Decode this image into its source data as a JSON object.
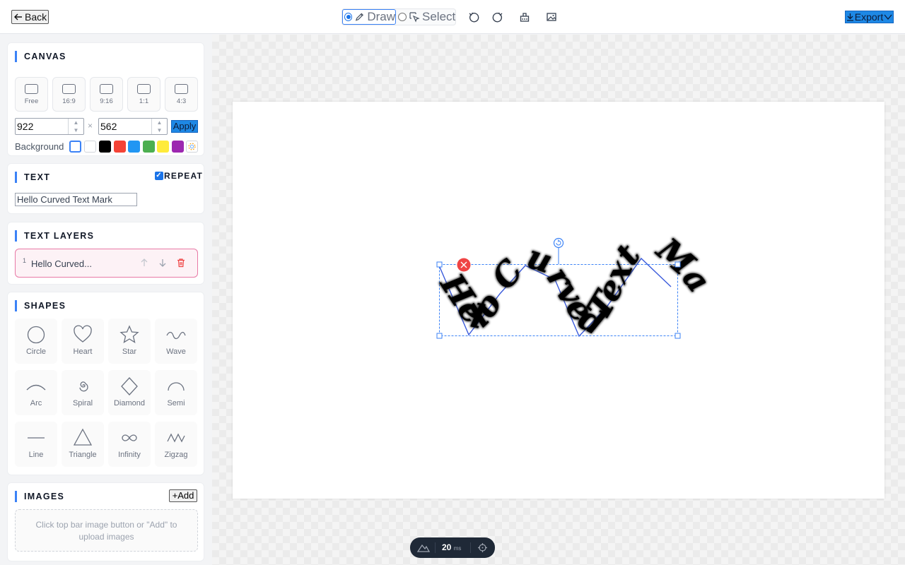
{
  "topbar": {
    "back_label": "Back",
    "modes": {
      "draw": "Draw",
      "select": "Select",
      "active": "draw"
    },
    "export_label": "Export"
  },
  "canvas_card": {
    "title": "CANVAS",
    "ratios": [
      {
        "label": "Free"
      },
      {
        "label": "16:9"
      },
      {
        "label": "9:16"
      },
      {
        "label": "1:1"
      },
      {
        "label": "4:3"
      }
    ],
    "width_value": "922",
    "height_value": "562",
    "times_symbol": "×",
    "apply_label": "Apply",
    "background_label": "Background",
    "background_colors": [
      "#ffffff",
      "#ffffff",
      "#000000",
      "#f44336",
      "#2196f3",
      "#4caf50",
      "#ffeb3b",
      "#9c27b0"
    ]
  },
  "text_card": {
    "title": "TEXT",
    "repeat_label": "REPEAT",
    "repeat_checked": true,
    "text_value": "Hello Curved Text Mark"
  },
  "layers_card": {
    "title": "TEXT LAYERS",
    "layers": [
      {
        "index": "1",
        "name": "Hello Curved..."
      }
    ]
  },
  "shapes_card": {
    "title": "SHAPES",
    "shapes": [
      {
        "label": "Circle",
        "icon": "circle-icon"
      },
      {
        "label": "Heart",
        "icon": "heart-icon"
      },
      {
        "label": "Star",
        "icon": "star-icon"
      },
      {
        "label": "Wave",
        "icon": "wave-icon"
      },
      {
        "label": "Arc",
        "icon": "arc-icon"
      },
      {
        "label": "Spiral",
        "icon": "spiral-icon"
      },
      {
        "label": "Diamond",
        "icon": "diamond-icon"
      },
      {
        "label": "Semi",
        "icon": "semi-icon"
      },
      {
        "label": "Line",
        "icon": "line-icon"
      },
      {
        "label": "Triangle",
        "icon": "triangle-icon"
      },
      {
        "label": "Infinity",
        "icon": "infinity-icon"
      },
      {
        "label": "Zigzag",
        "icon": "zigzag-icon"
      }
    ]
  },
  "images_card": {
    "title": "IMAGES",
    "add_label": "Add",
    "placeholder": "Click top bar image button or \"Add\" to upload images"
  },
  "artboard": {
    "curved_text": "Hello Curved Text Mark Hello Curved Text Mark"
  },
  "stats": {
    "value": "20",
    "unit": "ms"
  },
  "colors": {
    "accent": "#3b82f6",
    "button_blue": "#1e88e5",
    "delete_red": "#ef4444",
    "layer_pink": "#e879a6"
  }
}
